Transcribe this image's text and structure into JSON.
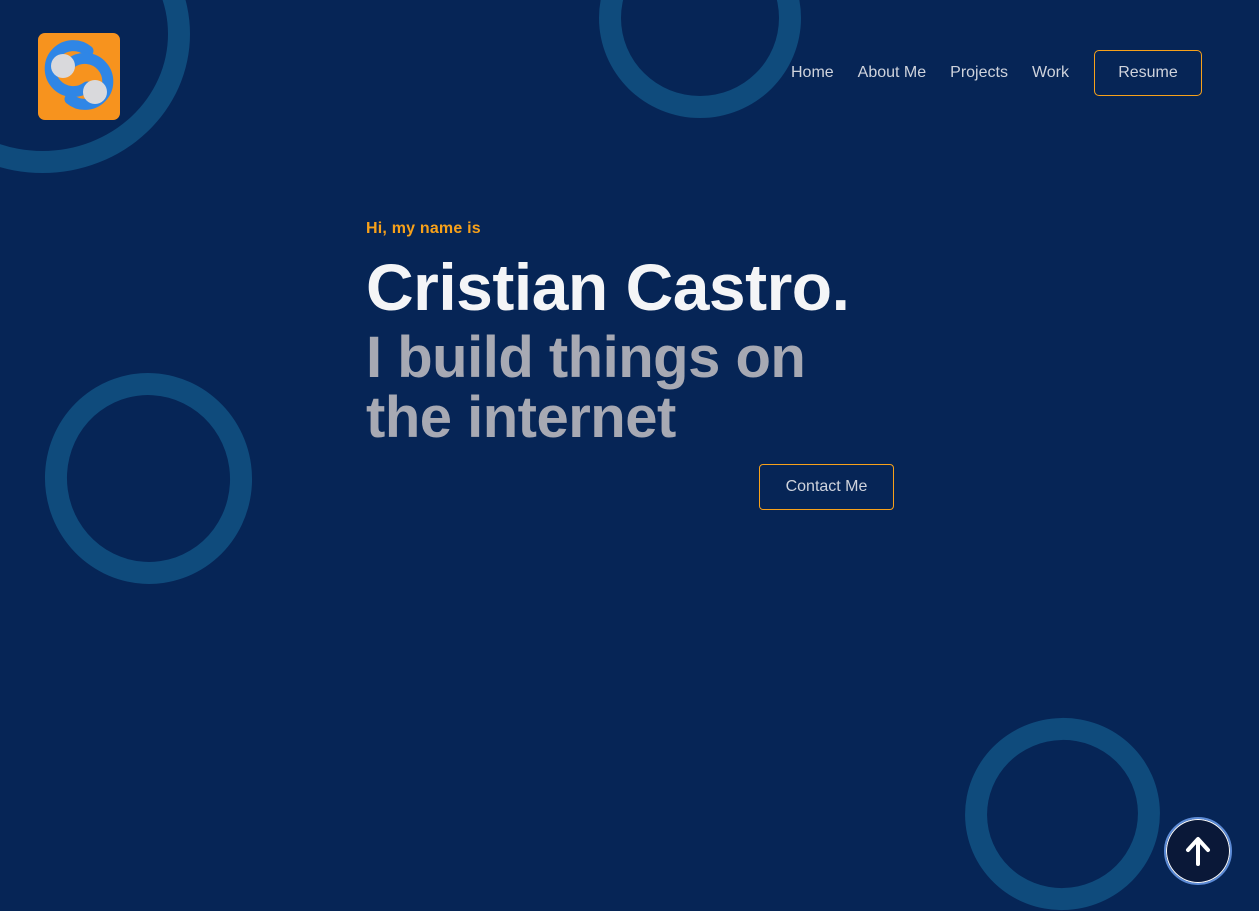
{
  "brand": {
    "logo_icon": "cs-monogram-logo",
    "logo_bg_color": "#f7931e",
    "logo_accent_color": "#2f86e6"
  },
  "nav": {
    "items": [
      {
        "label": "Home"
      },
      {
        "label": "About Me"
      },
      {
        "label": "Projects"
      },
      {
        "label": "Work"
      }
    ],
    "resume_label": "Resume"
  },
  "hero": {
    "greeting": "Hi, my name is",
    "name": "Cristian Castro.",
    "tagline": "I build things on the internet",
    "contact_label": "Contact Me"
  },
  "scroll_top": {
    "icon": "arrow-up-icon"
  },
  "colors": {
    "background": "#062556",
    "accent": "#f7a11a",
    "ring": "#0f4b7c",
    "heading": "#f4f5f7",
    "subheading": "#a7a9b3"
  }
}
